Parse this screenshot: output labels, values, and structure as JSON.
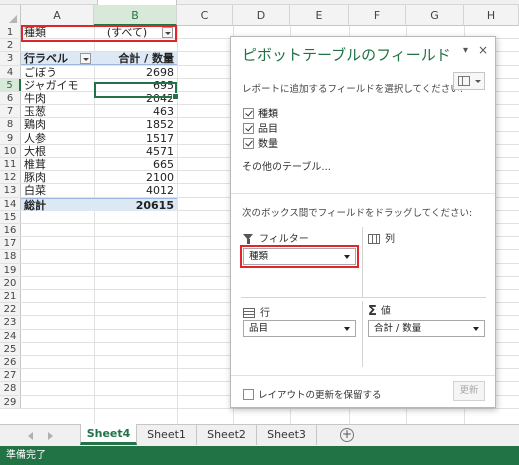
{
  "columns": [
    "A",
    "B",
    "C",
    "D",
    "E",
    "F",
    "G",
    "H"
  ],
  "rows": [
    "1",
    "2",
    "3",
    "4",
    "5",
    "6",
    "7",
    "8",
    "9",
    "10",
    "11",
    "12",
    "13",
    "14",
    "15",
    "16",
    "17",
    "18",
    "19",
    "20",
    "21",
    "22",
    "23",
    "24",
    "25",
    "26",
    "27",
    "28",
    "29"
  ],
  "active_cell": "B5",
  "pivot": {
    "filter_label": "種類",
    "filter_value": "(すべて)",
    "row_label_header": "行ラベル",
    "value_header": "合計 / 数量",
    "items": [
      {
        "label": "ごぼう",
        "value": "2698"
      },
      {
        "label": "ジャガイモ",
        "value": "695"
      },
      {
        "label": "牛肉",
        "value": "2042"
      },
      {
        "label": "玉葱",
        "value": "463"
      },
      {
        "label": "鶏肉",
        "value": "1852"
      },
      {
        "label": "人参",
        "value": "1517"
      },
      {
        "label": "大根",
        "value": "4571"
      },
      {
        "label": "椎茸",
        "value": "665"
      },
      {
        "label": "豚肉",
        "value": "2100"
      },
      {
        "label": "白菜",
        "value": "4012"
      }
    ],
    "total_label": "総計",
    "total_value": "20615"
  },
  "field_pane": {
    "title": "ピボットテーブルのフィールド",
    "pin_glyph": "▾",
    "close_glyph": "×",
    "subtitle": "レポートに追加するフィールドを選択してください:",
    "layout_icon": "layout-tools-icon",
    "fields": [
      {
        "label": "種類",
        "checked": true
      },
      {
        "label": "品目",
        "checked": true
      },
      {
        "label": "数量",
        "checked": true
      }
    ],
    "other_tables": "その他のテーブル...",
    "drag_hint": "次のボックス間でフィールドをドラッグしてください:",
    "areas": {
      "filters": {
        "label": "フィルター",
        "item": "種類"
      },
      "columns": {
        "label": "列"
      },
      "rows": {
        "label": "行",
        "item": "品目"
      },
      "values": {
        "label": "値",
        "item": "合計 / 数量"
      }
    },
    "defer_update": "レイアウトの更新を保留する",
    "update_button": "更新"
  },
  "sheets": {
    "tabs": [
      "Sheet4",
      "Sheet1",
      "Sheet2",
      "Sheet3"
    ],
    "active": "Sheet4",
    "add_glyph": "+"
  },
  "status": "準備完了",
  "colors": {
    "accent": "#217346",
    "highlight": "#e0262b",
    "pivot_header_bg": "#dde8f5"
  }
}
